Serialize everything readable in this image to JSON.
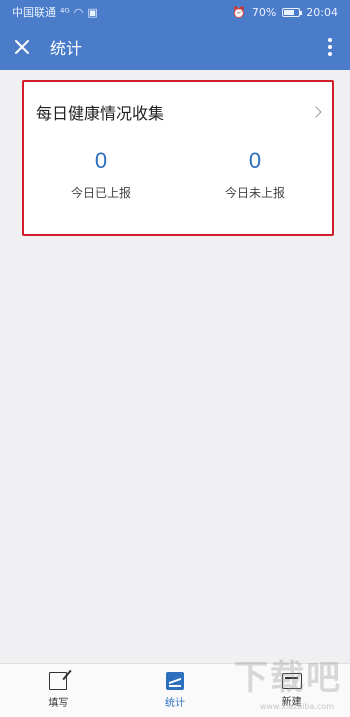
{
  "status_bar": {
    "carrier": "中国联通",
    "signal": "⁴ᴳ",
    "battery": "70%",
    "battery_fraction": 0.7,
    "time": "20:04"
  },
  "header": {
    "title": "统计",
    "close_icon": "close-icon",
    "more_icon": "more-vertical-icon"
  },
  "card": {
    "title": "每日健康情况收集",
    "stats": [
      {
        "value": "0",
        "label": "今日已上报"
      },
      {
        "value": "0",
        "label": "今日未上报"
      }
    ],
    "highlight_color": "#d11c2a"
  },
  "tabbar": {
    "tabs": [
      {
        "label": "填写",
        "icon": "edit-icon"
      },
      {
        "label": "统计",
        "icon": "stats-icon",
        "active": true
      },
      {
        "label": "新建",
        "icon": "new-icon"
      }
    ]
  },
  "watermark": {
    "text": "下载吧",
    "url": "www.xiazaiba.com"
  },
  "colors": {
    "accent": "#4a7cc9",
    "value": "#2c6fbf"
  }
}
